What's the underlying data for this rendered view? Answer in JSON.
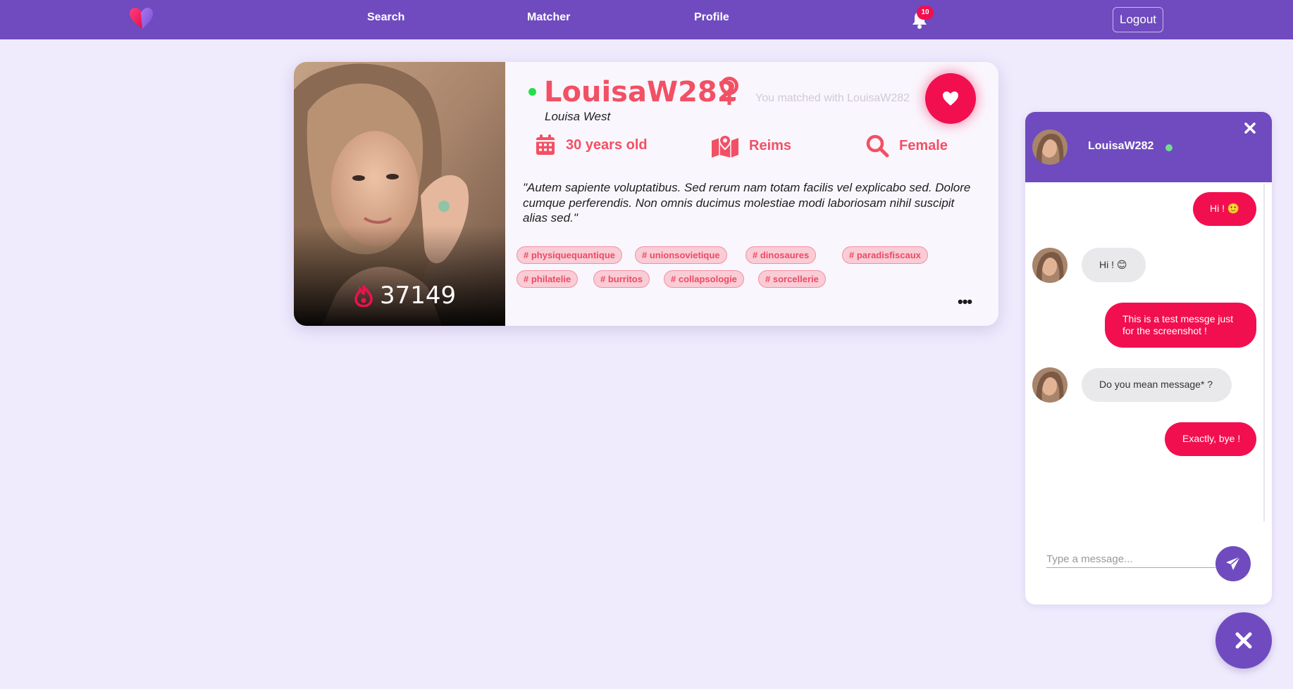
{
  "nav": {
    "search": "Search",
    "matcher": "Matcher",
    "profile": "Profile",
    "notification_count": "10",
    "logout": "Logout"
  },
  "profile": {
    "username": "LouisaW282",
    "real_name": "Louisa West",
    "online": true,
    "matched_text": "You matched with LouisaW282",
    "popularity": "37149",
    "age": "30 years old",
    "city": "Reims",
    "looking_for": "Female",
    "bio": "\"Autem sapiente voluptatibus. Sed rerum nam totam facilis vel explicabo sed. Dolore cumque perferendis. Non omnis ducimus molestiae modi laboriosam nihil suscipit alias sed.\"",
    "tags": [
      "physiquequantique",
      "unionsovietique",
      "dinosaures",
      "paradisfiscaux",
      "philatelie",
      "burritos",
      "collapsologie",
      "sorcellerie"
    ],
    "icons": {
      "gender": "female-symbol-icon",
      "age": "calendar-icon",
      "city": "map-marker-icon",
      "looking_for": "search-icon",
      "like": "heart-icon",
      "popularity": "flame-icon",
      "more": "ellipsis-icon"
    }
  },
  "chat": {
    "contact_name": "LouisaW282",
    "messages": [
      {
        "from": "me",
        "text": "Hi ! 🙂"
      },
      {
        "from": "them",
        "text": "Hi ! 😊"
      },
      {
        "from": "me",
        "text": "This is a test messge just for the screenshot !"
      },
      {
        "from": "them",
        "text": "Do you mean message* ?"
      },
      {
        "from": "me",
        "text": "Exactly, bye !"
      }
    ],
    "input_placeholder": "Type a message..."
  },
  "colors": {
    "brand_purple": "#6f4bbf",
    "accent_pink": "#f20f4f",
    "tag_text": "#ee4a63",
    "background": "#efebfd"
  }
}
